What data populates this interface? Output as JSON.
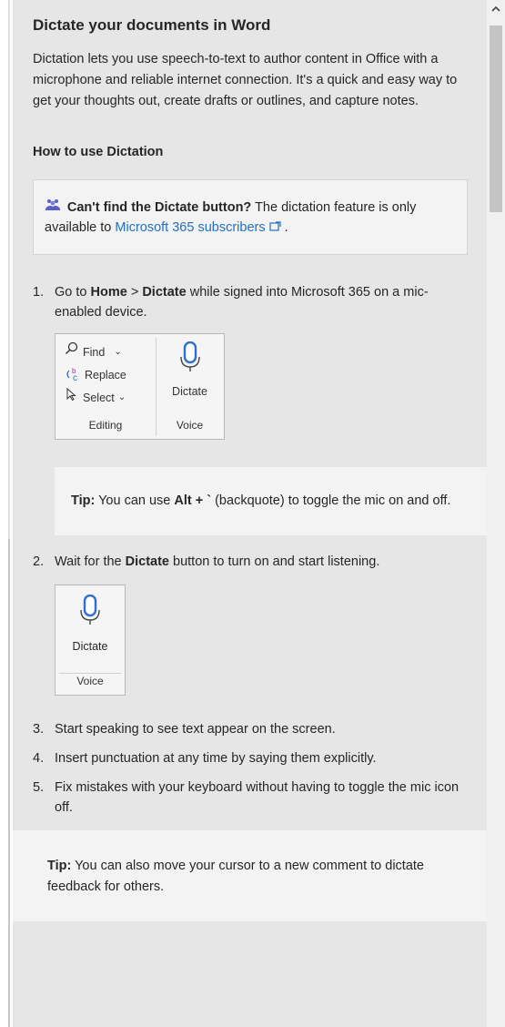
{
  "article": {
    "title": "Dictate your documents in Word",
    "intro": "Dictation lets you use speech-to-text to author content in Office with a microphone and reliable internet connection. It's a quick and easy way to get your thoughts out, create drafts or outlines, and capture notes.",
    "section_heading": "How to use Dictation"
  },
  "note": {
    "icon": "people-icon",
    "bold": "Can't find the Dictate button?",
    "text": " The dictation feature is only available to ",
    "link": "Microsoft 365 subscribers",
    "after": "."
  },
  "steps": [
    {
      "num": "1.",
      "pre": "Go to ",
      "b1": "Home",
      "mid": " > ",
      "b2": "Dictate",
      "post": " while signed into Microsoft 365 on a mic-enabled device."
    },
    {
      "num": "2.",
      "pre": "Wait for the ",
      "b1": "Dictate",
      "post": " button to turn on and start listening."
    },
    {
      "num": "3.",
      "text": "Start speaking to see text appear on the screen."
    },
    {
      "num": "4.",
      "text": "Insert punctuation at any time by saying them explicitly."
    },
    {
      "num": "5.",
      "text": "Fix mistakes with your keyboard without having to toggle the mic icon off."
    }
  ],
  "ribbon": {
    "find": "Find",
    "replace": "Replace",
    "select": "Select",
    "editing": "Editing",
    "dictate": "Dictate",
    "voice": "Voice"
  },
  "tip1": {
    "label": "Tip:",
    "pre": " You can use ",
    "key": "Alt + `",
    "post": " (backquote) to toggle the mic on and off."
  },
  "tip2": {
    "label": "Tip:",
    "text": " You can also move your cursor to a new comment to dictate feedback for others."
  },
  "colors": {
    "link": "#1f6fc4",
    "mic_blue": "#2f6fd1",
    "pane_bg": "#e6e6e6"
  }
}
